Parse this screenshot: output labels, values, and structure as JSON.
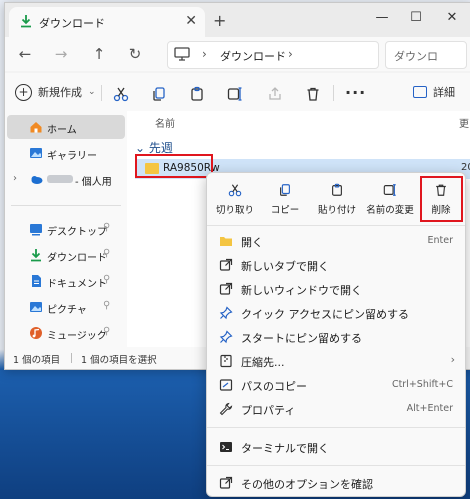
{
  "window": {
    "tab_title": "ダウンロード",
    "tab_close": "✕",
    "new_tab": "+",
    "btn_min": "—",
    "btn_max": "☐",
    "btn_close": "✕"
  },
  "nav": {
    "back": "←",
    "forward": "→",
    "up": "↑",
    "refresh": "↻",
    "address_sep": "›",
    "address_crumb": "ダウンロード",
    "search_placeholder": "ダウンロ"
  },
  "toolbar": {
    "new_label": "新規作成",
    "new_chevron": "⌄",
    "more": "···",
    "details_label": "詳細"
  },
  "sidebar": {
    "home": "ホーム",
    "gallery": "ギャラリー",
    "onedrive": "- 個人用",
    "expander": "›",
    "pinned": [
      {
        "label": "デスクトップ"
      },
      {
        "label": "ダウンロード"
      },
      {
        "label": "ドキュメント"
      },
      {
        "label": "ピクチャ"
      },
      {
        "label": "ミュージック"
      }
    ],
    "pin_glyph": "📌"
  },
  "content": {
    "column_name": "名前",
    "column_date": "更",
    "group_chevron": "⌄",
    "group_label": "先週",
    "file_name": "RA9850Rw",
    "file_date": "20"
  },
  "status": {
    "count": "1 個の項目",
    "selected": "1 個の項目を選択"
  },
  "menu": {
    "quick_actions": [
      {
        "label": "切り取り",
        "icon": "scissors-icon"
      },
      {
        "label": "コピー",
        "icon": "copy-icon"
      },
      {
        "label": "貼り付け",
        "icon": "paste-icon"
      },
      {
        "label": "名前の変更",
        "icon": "rename-icon"
      },
      {
        "label": "削除",
        "icon": "trash-icon"
      }
    ],
    "items": [
      {
        "label": "開く",
        "shortcut": "Enter"
      },
      {
        "label": "新しいタブで開く",
        "shortcut": ""
      },
      {
        "label": "新しいウィンドウで開く",
        "shortcut": ""
      },
      {
        "label": "クイック アクセスにピン留めする",
        "shortcut": ""
      },
      {
        "label": "スタートにピン留めする",
        "shortcut": ""
      },
      {
        "label": "圧縮先...",
        "shortcut": "›"
      },
      {
        "label": "パスのコピー",
        "shortcut": "Ctrl+Shift+C"
      },
      {
        "label": "プロパティ",
        "shortcut": "Alt+Enter"
      },
      {
        "label": "ターミナルで開く",
        "shortcut": ""
      },
      {
        "label": "その他のオプションを確認",
        "shortcut": ""
      }
    ]
  },
  "colors": {
    "highlight_red": "#e0161e",
    "accent_blue": "#2663c6",
    "folder_yellow": "#f4c542",
    "selection": "#cfe3f8"
  }
}
